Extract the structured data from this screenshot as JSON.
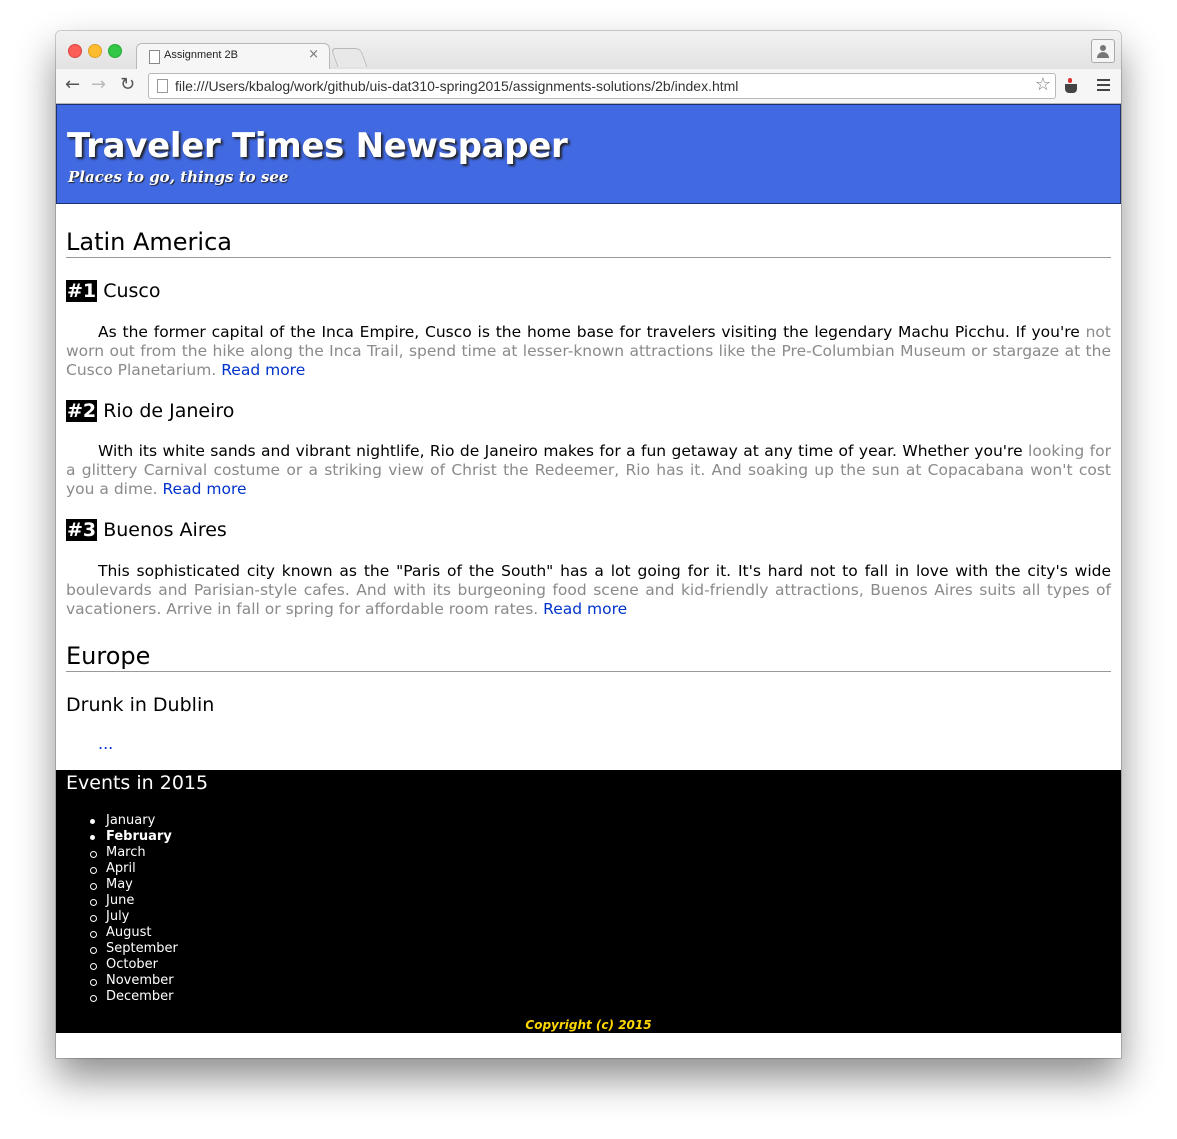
{
  "browser": {
    "tab_title": "Assignment 2B",
    "tab_close": "×",
    "url": "file:///Users/kbalog/work/github/uis-dat310-spring2015/assignments-solutions/2b/index.html"
  },
  "masthead": {
    "title": "Traveler Times Newspaper",
    "tagline": "Places to go, things to see"
  },
  "sections": [
    {
      "title": "Latin America",
      "articles": [
        {
          "rank": "#1",
          "title": "Cusco",
          "lead": "As the former capital of the Inca Empire, Cusco is the home base for travelers visiting the legendary Machu Picchu. If you're",
          "rest": "not worn out from the hike along the Inca Trail, spend time at lesser-known attractions like the Pre-Columbian Museum or stargaze at the Cusco Planetarium.",
          "link": "Read more"
        },
        {
          "rank": "#2",
          "title": "Rio de Janeiro",
          "lead": "With its white sands and vibrant nightlife, Rio de Janeiro makes for a fun getaway at any time of year. Whether you're",
          "rest": "looking for a glittery Carnival costume or a striking view of Christ the Redeemer, Rio has it. And soaking up the sun at Copacabana won't cost you a dime.",
          "link": "Read more"
        },
        {
          "rank": "#3",
          "title": "Buenos Aires",
          "lead": "This sophisticated city known as the \"Paris of the South\" has a lot going for it. It's hard not to fall in love with the city's wide",
          "rest": "boulevards and Parisian-style cafes. And with its burgeoning food scene and kid-friendly attractions, Buenos Aires suits all types of vacationers. Arrive in fall or spring for affordable room rates.",
          "link": "Read more"
        }
      ]
    },
    {
      "title": "Europe",
      "articles": [
        {
          "title": "Drunk in Dublin",
          "link": "..."
        }
      ]
    }
  ],
  "events": {
    "title": "Events in 2015",
    "months": [
      "January",
      "February",
      "March",
      "April",
      "May",
      "June",
      "July",
      "August",
      "September",
      "October",
      "November",
      "December"
    ],
    "copyright": "Copyright (c) 2015"
  }
}
